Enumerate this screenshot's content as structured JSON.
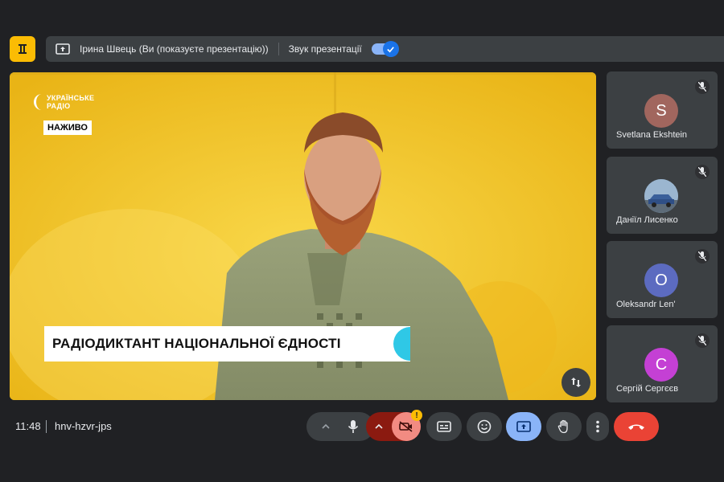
{
  "presentation_bar": {
    "presenter_text": "Ірина Швець (Ви (показуєте презентацію))",
    "sound_label": "Звук презентації",
    "sound_enabled": true
  },
  "stage": {
    "logo_line1": "УКРАЇНСЬКЕ",
    "logo_line2": "РАДІО",
    "live_badge": "НАЖИВО",
    "title": "РАДІОДИКТАНТ НАЦІОНАЛЬНОЇ ЄДНОСТІ"
  },
  "participants": [
    {
      "name": "Svetlana Ekshtein",
      "initial": "S",
      "color": "#a1665e",
      "muted": true
    },
    {
      "name": "Даніїл Лисенко",
      "initial": "",
      "color": "#6b8fb3",
      "muted": true
    },
    {
      "name": "Oleksandr Len'",
      "initial": "O",
      "color": "#5c6bc0",
      "muted": true
    },
    {
      "name": "Сергій Сергєєв",
      "initial": "C",
      "color": "#c440d4",
      "muted": true
    }
  ],
  "bottom_bar": {
    "time": "11:48",
    "meeting_code": "hnv-hzvr-jps",
    "camera_warning": "!"
  },
  "colors": {
    "accent": "#8ab4f8",
    "end_call": "#ea4335",
    "camera_off": "#f28b82"
  }
}
